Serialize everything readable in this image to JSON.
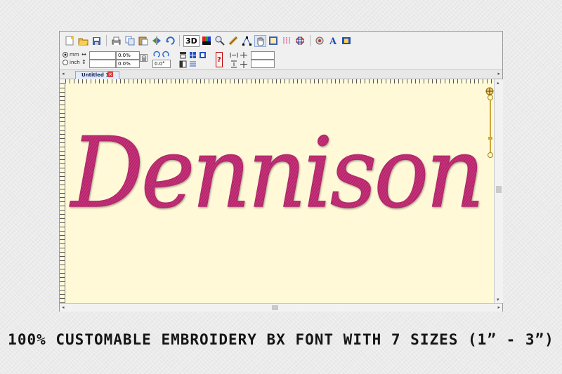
{
  "colors": {
    "thread": "#c8307a",
    "canvas": "#fff9d8",
    "caption": "#151515"
  },
  "toolbar": {
    "icons": [
      "new-file-icon",
      "open-folder-icon",
      "save-icon",
      "print-icon",
      "copy-icon",
      "paste-icon",
      "mirror-icon",
      "rotate-icon",
      "3d-view-icon",
      "color-palette-icon",
      "zoom-icon",
      "measure-icon",
      "node-edit-icon",
      "hand-pan-icon",
      "hoop-icon",
      "stitch-player-icon",
      "grid-icon",
      "settings-icon",
      "text-tool-icon",
      "monogram-icon"
    ],
    "view_3d_label": "3D"
  },
  "units": {
    "mm_label": "mm",
    "inch_label": "inch"
  },
  "fields": {
    "width_value": "",
    "height_value": "",
    "width_percent": "0.0%",
    "height_percent": "0.0%",
    "angle_value": "0.0°",
    "extra_1": "",
    "extra_2": ""
  },
  "tabs": [
    {
      "label": "Untitled 1 *"
    }
  ],
  "design": {
    "text": "Dennison"
  },
  "caption": "100% CUSTOMABLE EMBROIDERY BX FONT WITH 7 SIZES (1” -  3”)"
}
